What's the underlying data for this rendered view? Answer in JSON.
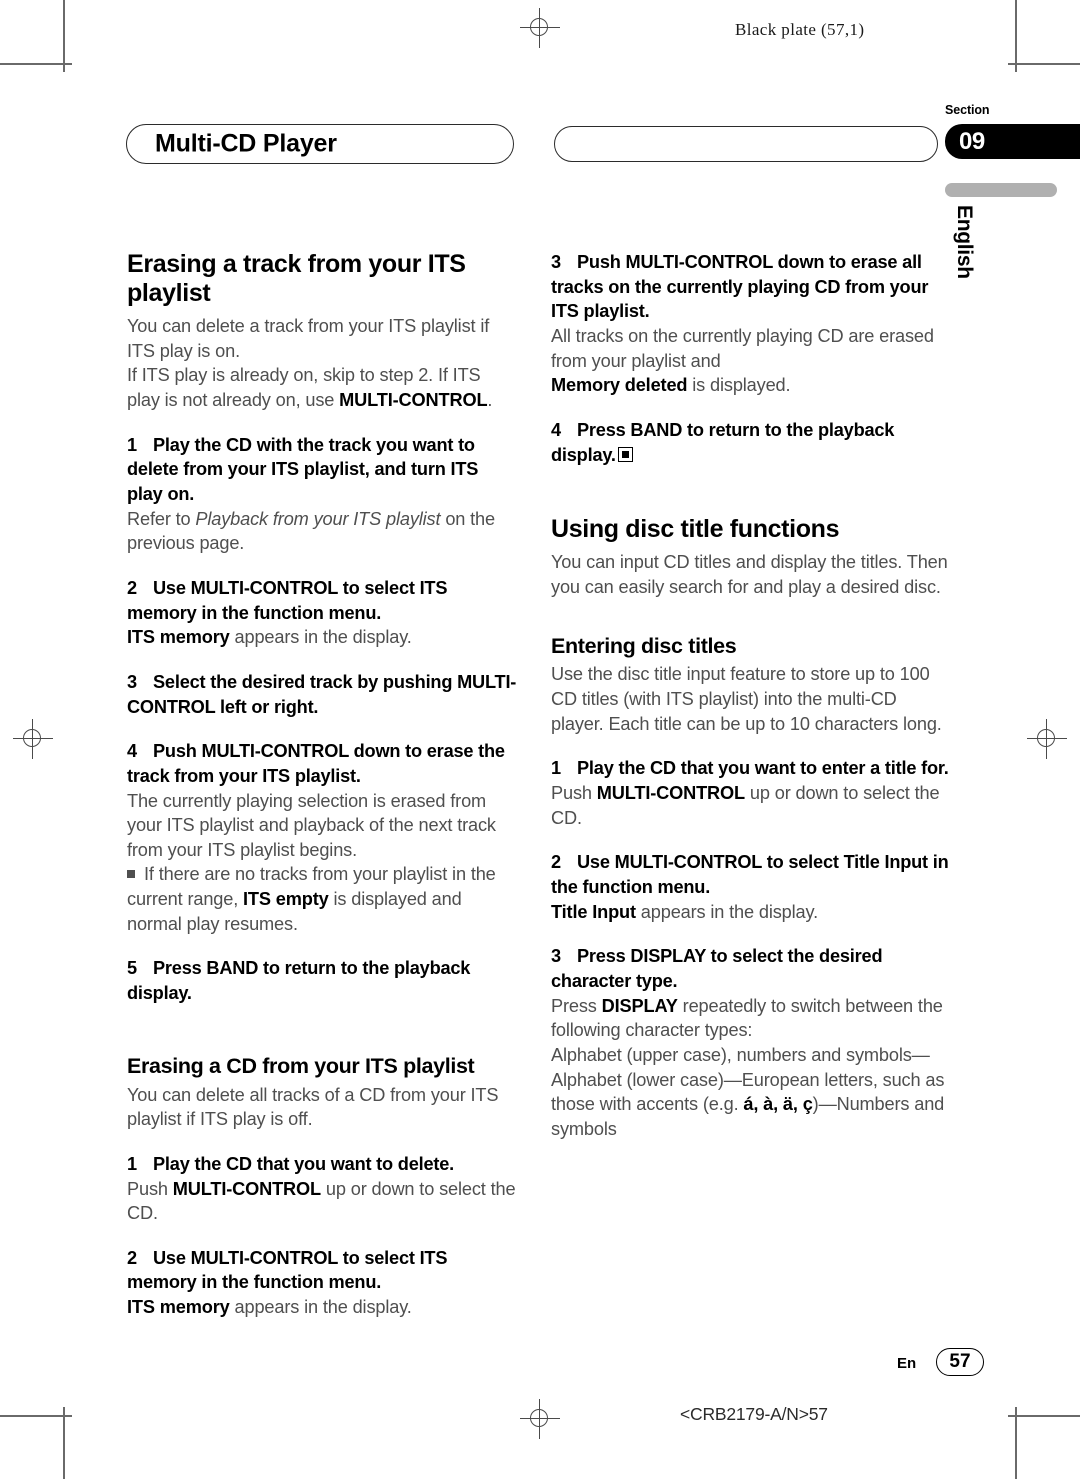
{
  "print_marks": {
    "plate_slug": "Black plate (57,1)"
  },
  "header": {
    "chapter_title": "Multi-CD Player",
    "section_label": "Section",
    "section_number": "09",
    "language_tab": "English"
  },
  "left_column": {
    "heading": "Erasing a track from your ITS playlist",
    "intro_1": "You can delete a track from your ITS playlist if ITS play is on.",
    "intro_2_a": "If ITS play is already on, skip to step 2. If ITS play is not already on, use ",
    "intro_2_b": "MULTI-CONTROL",
    "intro_2_c": ".",
    "step1_num": "1",
    "step1_text": "Play the CD with the track you want to delete from your ITS playlist, and turn ITS play on.",
    "step1_note_a": "Refer to ",
    "step1_note_b": "Playback from your ITS playlist",
    "step1_note_c": " on the previous page.",
    "step2_num": "2",
    "step2_text": "Use MULTI-CONTROL to select ITS memory in the function menu.",
    "step2_note_a": "ITS memory",
    "step2_note_b": " appears in the display.",
    "step3_num": "3",
    "step3_text": "Select the desired track by pushing MULTI-CONTROL left or right.",
    "step4_num": "4",
    "step4_text": "Push MULTI-CONTROL down to erase the track from your ITS playlist.",
    "step4_note": "The currently playing selection is erased from your ITS playlist and playback of the next track from your ITS playlist begins.",
    "bullet_a": "If there are no tracks from your playlist in the current range, ",
    "bullet_b": "ITS empty",
    "bullet_c": " is displayed and normal play resumes.",
    "step5_num": "5",
    "step5_text": "Press BAND to return to the playback display.",
    "heading2": "Erasing a CD from your ITS playlist",
    "intro2": "You can delete all tracks of a CD from your ITS playlist if ITS play is off.",
    "h2_step1_num": "1",
    "h2_step1_text": "Play the CD that you want to delete.",
    "h2_step1_note_a": "Push ",
    "h2_step1_note_b": "MULTI-CONTROL",
    "h2_step1_note_c": " up or down to select the CD.",
    "h2_step2_num": "2",
    "h2_step2_text": "Use MULTI-CONTROL to select ITS memory in the function menu.",
    "h2_step2_note_a": "ITS memory",
    "h2_step2_note_b": " appears in the display."
  },
  "right_column": {
    "step3_num": "3",
    "step3_text": "Push MULTI-CONTROL down to erase all tracks on the currently playing CD from your ITS playlist.",
    "step3_note_a": "All tracks on the currently playing CD are erased from your playlist and",
    "step3_note_b": "Memory deleted",
    "step3_note_c": " is displayed.",
    "step4_num": "4",
    "step4_text": "Press BAND to return to the playback display.",
    "heading": "Using disc title functions",
    "intro": "You can input CD titles and display the titles. Then you can easily search for and play a desired disc.",
    "subheading": "Entering disc titles",
    "sub_intro": "Use the disc title input feature to store up to 100 CD titles  (with ITS playlist) into the multi-CD player. Each title can be up to 10 characters long.",
    "s1_num": "1",
    "s1_text": "Play the CD that you want to enter a title for.",
    "s1_note_a": "Push ",
    "s1_note_b": "MULTI-CONTROL",
    "s1_note_c": " up or down to select the CD.",
    "s2_num": "2",
    "s2_text": "Use MULTI-CONTROL to select Title Input in the function menu.",
    "s2_note_a": "Title Input",
    "s2_note_b": " appears in the display.",
    "s3_num": "3",
    "s3_text": "Press DISPLAY to select the desired character type.",
    "s3_note_a": "Press ",
    "s3_note_b": "DISPLAY",
    "s3_note_c": " repeatedly to switch between the following character types:",
    "s3_note_d": "Alphabet (upper case), numbers and symbols—Alphabet (lower case)—European letters, such as those with accents (e.g. ",
    "s3_accents": "á, à, ä, ç",
    "s3_note_e": ")—Numbers and symbols"
  },
  "footer": {
    "language_code": "En",
    "page_number": "57",
    "doc_code": "<CRB2179-A/N>57"
  }
}
